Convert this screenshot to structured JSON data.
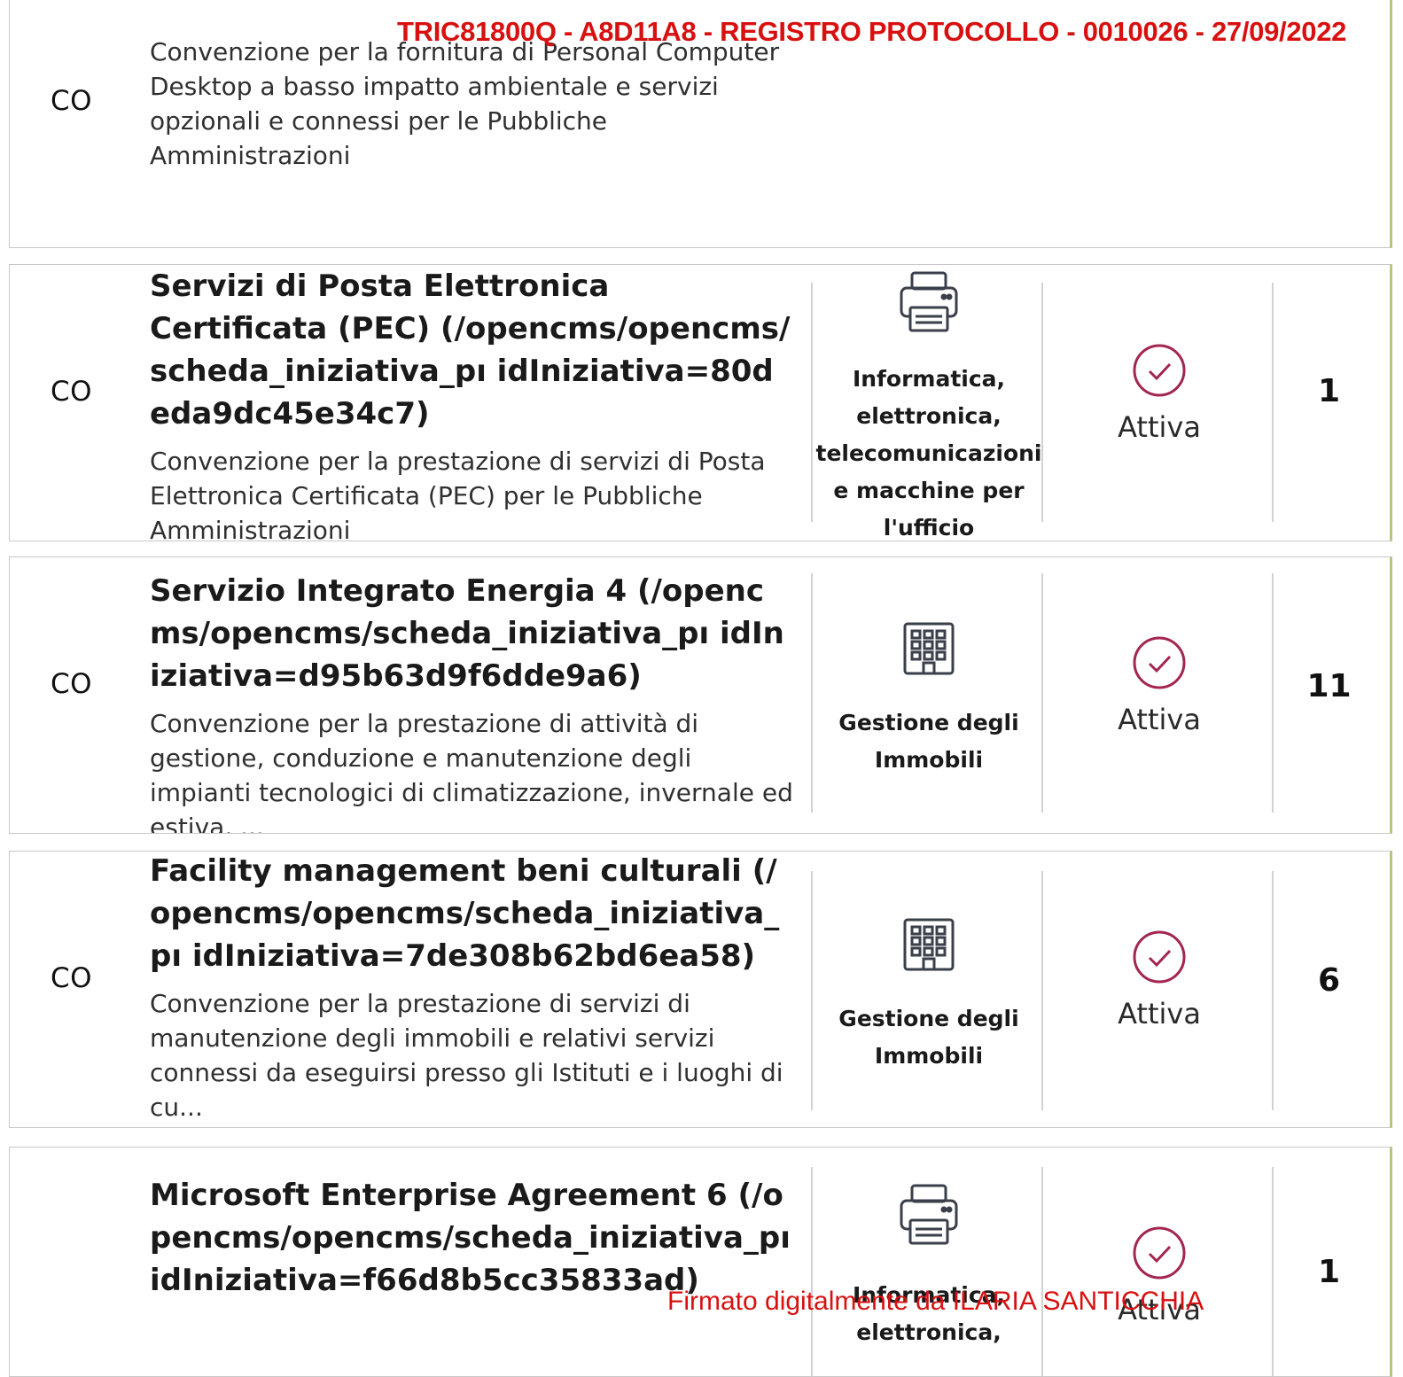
{
  "stamps": {
    "protocol": "TRIC81800Q - A8D11A8 - REGISTRO PROTOCOLLO - 0010026 - 27/09/2022",
    "signature": "Firmato digitalmente da ILARIA SANTICCHIA"
  },
  "colors": {
    "stamp_red": "#d81010",
    "status_icon": "#a3264f",
    "card_border": "#c8c8c8"
  },
  "rows": [
    {
      "code": "CO",
      "title_name": "",
      "title_link": "",
      "description": "Convenzione per la fornitura di Personal Computer Desktop a basso impatto ambientale e servizi opzionali e connessi per le Pubbliche Amministrazioni",
      "category": "",
      "status": "",
      "count": ""
    },
    {
      "code": "CO",
      "title_name": "Servizi di Posta Elettronica Certificata (PEC)",
      "title_link": "(/opencms/opencms/scheda_iniziativa_pı idIniziativa=80deda9dc45e34c7)",
      "description": "Convenzione per la prestazione di servizi di Posta Elettronica Certificata (PEC) per le Pubbliche Amministrazioni",
      "category": "Informatica, elettronica, telecomunicazioni e macchine per l'ufficio",
      "category_icon": "printer-icon",
      "status": "Attiva",
      "count": "1"
    },
    {
      "code": "CO",
      "title_name": "Servizio Integrato Energia 4",
      "title_link": "(/opencms/opencms/scheda_iniziativa_pı idIniziativa=d95b63d9f6dde9a6)",
      "description": "Convenzione per la prestazione di attività di gestione, conduzione e manutenzione degli impianti tecnologici di climatizzazione, invernale ed estiva, ...",
      "category": "Gestione degli Immobili",
      "category_icon": "building-icon",
      "status": "Attiva",
      "count": "11"
    },
    {
      "code": "CO",
      "title_name": "Facility management beni culturali",
      "title_link": "(/opencms/opencms/scheda_iniziativa_pı idIniziativa=7de308b62bd6ea58)",
      "description": "Convenzione per la prestazione di servizi di manutenzione degli immobili e relativi servizi connessi da eseguirsi presso gli Istituti e i luoghi di cu...",
      "category": "Gestione degli Immobili",
      "category_icon": "building-icon",
      "status": "Attiva",
      "count": "6"
    },
    {
      "code": "",
      "title_name": "Microsoft Enterprise Agreement 6",
      "title_link": "(/opencms/opencms/scheda_iniziativa_pı idIniziativa=f66d8b5cc35833ad)",
      "description": "",
      "category": "Informatica, elettronica,",
      "category_icon": "printer-icon",
      "status": "Attiva",
      "count": "1"
    }
  ]
}
